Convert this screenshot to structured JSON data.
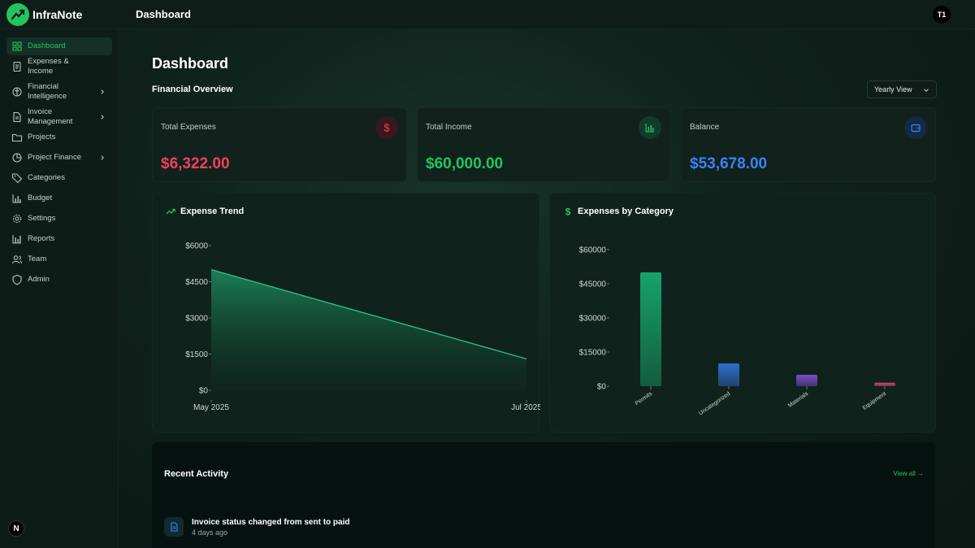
{
  "app": {
    "name": "InfraNote",
    "header_title": "Dashboard",
    "avatar_initials": "T1",
    "corner_badge": "N"
  },
  "sidebar": {
    "items": [
      {
        "label": "Dashboard",
        "icon": "grid-icon",
        "active": true,
        "chevron": false
      },
      {
        "label": "Expenses & Income",
        "icon": "receipt-icon",
        "active": false,
        "chevron": false
      },
      {
        "label": "Financial Intelligence",
        "icon": "brain-icon",
        "active": false,
        "chevron": true
      },
      {
        "label": "Invoice Management",
        "icon": "document-icon",
        "active": false,
        "chevron": true
      },
      {
        "label": "Projects",
        "icon": "folder-icon",
        "active": false,
        "chevron": false
      },
      {
        "label": "Project Finance",
        "icon": "pie-chart-icon",
        "active": false,
        "chevron": true
      },
      {
        "label": "Categories",
        "icon": "tag-icon",
        "active": false,
        "chevron": false
      },
      {
        "label": "Budget",
        "icon": "bar-chart-icon",
        "active": false,
        "chevron": false
      },
      {
        "label": "Settings",
        "icon": "gear-icon",
        "active": false,
        "chevron": false
      },
      {
        "label": "Reports",
        "icon": "report-icon",
        "active": false,
        "chevron": false
      },
      {
        "label": "Team",
        "icon": "users-icon",
        "active": false,
        "chevron": false
      },
      {
        "label": "Admin",
        "icon": "shield-icon",
        "active": false,
        "chevron": false
      }
    ]
  },
  "main": {
    "page_title": "Dashboard",
    "section_title": "Financial Overview",
    "view_select": "Yearly View",
    "cards": [
      {
        "title": "Total Expenses",
        "value": "$6,322.00",
        "color": "#f43f5e",
        "icon": "dollar-icon"
      },
      {
        "title": "Total Income",
        "value": "$60,000.00",
        "color": "#22c55e",
        "icon": "bar-chart-icon"
      },
      {
        "title": "Balance",
        "value": "$53,678.00",
        "color": "#3b82f6",
        "icon": "wallet-icon"
      }
    ],
    "expense_trend_title": "Expense Trend",
    "category_title": "Expenses by Category"
  },
  "chart_data": [
    {
      "type": "area",
      "title": "Expense Trend",
      "x": [
        "May 2025",
        "Jul 2025"
      ],
      "values": [
        5000,
        1300
      ],
      "y_ticks": [
        "$0",
        "$1500",
        "$3000",
        "$4500",
        "$6000"
      ],
      "ylim": [
        0,
        6000
      ],
      "grid": false
    },
    {
      "type": "bar",
      "title": "Expenses by Category",
      "categories": [
        "Permits",
        "Uncategorized",
        "Materials",
        "Equipment"
      ],
      "values": [
        50000,
        10000,
        5000,
        1500
      ],
      "colors": [
        "#16a36a",
        "#2f6fd0",
        "#7c4dcc",
        "#d9467a"
      ],
      "y_ticks": [
        "$0",
        "$15000",
        "$30000",
        "$45000",
        "$60000"
      ],
      "ylim": [
        0,
        60000
      ],
      "grid": false
    }
  ],
  "activity": {
    "title": "Recent Activity",
    "view_all": "View all →",
    "items": [
      {
        "text": "Invoice status changed from sent to paid",
        "time": "4 days ago"
      }
    ]
  }
}
